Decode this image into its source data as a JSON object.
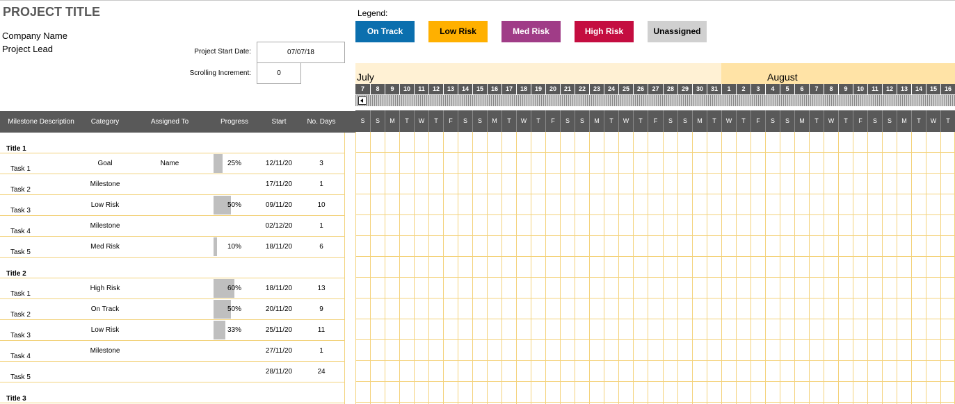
{
  "header": {
    "project_title": "PROJECT TITLE",
    "company_name": "Company Name",
    "project_lead": "Project Lead",
    "start_date_label": "Project Start Date:",
    "start_date_value": "07/07/18",
    "scroll_increment_label": "Scrolling Increment:",
    "scroll_increment_value": "0"
  },
  "legend": {
    "label": "Legend:",
    "items": [
      {
        "label": "On Track",
        "bg": "#0B6FAE",
        "fg": "#FFFFFF"
      },
      {
        "label": "Low Risk",
        "bg": "#FFB000",
        "fg": "#000000"
      },
      {
        "label": "Med Risk",
        "bg": "#A03C87",
        "fg": "#FFFFFF"
      },
      {
        "label": "High Risk",
        "bg": "#C40D40",
        "fg": "#FFFFFF"
      },
      {
        "label": "Unassigned",
        "bg": "#D0D0D0",
        "fg": "#000000"
      }
    ]
  },
  "timeline": {
    "months": [
      {
        "label": "July",
        "color": "#FFF1D4"
      },
      {
        "label": "August",
        "color": "#FFE3A6"
      }
    ],
    "dates": [
      7,
      8,
      9,
      10,
      11,
      12,
      13,
      14,
      15,
      16,
      17,
      18,
      19,
      20,
      21,
      22,
      23,
      24,
      25,
      26,
      27,
      28,
      29,
      30,
      31,
      1,
      2,
      3,
      4,
      5,
      6,
      7,
      8,
      9,
      10,
      11,
      12,
      13,
      14,
      15,
      16
    ],
    "weekdays": [
      "S",
      "S",
      "M",
      "T",
      "W",
      "T",
      "F",
      "S",
      "S",
      "M",
      "T",
      "W",
      "T",
      "F",
      "S",
      "S",
      "M",
      "T",
      "W",
      "T",
      "F",
      "S",
      "S",
      "M",
      "T",
      "W",
      "T",
      "F",
      "S",
      "S",
      "M",
      "T",
      "W",
      "T",
      "F",
      "S",
      "S",
      "M",
      "T",
      "W",
      "T"
    ]
  },
  "table": {
    "columns": [
      "Milestone Description",
      "Category",
      "Assigned To",
      "Progress",
      "Start",
      "No. Days"
    ],
    "rows": [
      {
        "type": "title",
        "label": "Title 1"
      },
      {
        "type": "task",
        "label": "Task 1",
        "category": "Goal",
        "assigned": "Name",
        "progress": 25,
        "progress_text": "25%",
        "start": "12/11/20",
        "days": "3"
      },
      {
        "type": "task",
        "label": "Task 2",
        "category": "Milestone",
        "assigned": "",
        "progress": null,
        "progress_text": "",
        "start": "17/11/20",
        "days": "1"
      },
      {
        "type": "task",
        "label": "Task 3",
        "category": "Low Risk",
        "assigned": "",
        "progress": 50,
        "progress_text": "50%",
        "start": "09/11/20",
        "days": "10"
      },
      {
        "type": "task",
        "label": "Task 4",
        "category": "Milestone",
        "assigned": "",
        "progress": null,
        "progress_text": "",
        "start": "02/12/20",
        "days": "1"
      },
      {
        "type": "task",
        "label": "Task 5",
        "category": "Med Risk",
        "assigned": "",
        "progress": 10,
        "progress_text": "10%",
        "start": "18/11/20",
        "days": "6"
      },
      {
        "type": "title",
        "label": "Title 2"
      },
      {
        "type": "task",
        "label": "Task 1",
        "category": "High Risk",
        "assigned": "",
        "progress": 60,
        "progress_text": "60%",
        "start": "18/11/20",
        "days": "13"
      },
      {
        "type": "task",
        "label": "Task 2",
        "category": "On Track",
        "assigned": "",
        "progress": 50,
        "progress_text": "50%",
        "start": "20/11/20",
        "days": "9"
      },
      {
        "type": "task",
        "label": "Task 3",
        "category": "Low Risk",
        "assigned": "",
        "progress": 33,
        "progress_text": "33%",
        "start": "25/11/20",
        "days": "11"
      },
      {
        "type": "task",
        "label": "Task 4",
        "category": "Milestone",
        "assigned": "",
        "progress": null,
        "progress_text": "",
        "start": "27/11/20",
        "days": "1"
      },
      {
        "type": "task",
        "label": "Task 5",
        "category": "",
        "assigned": "",
        "progress": null,
        "progress_text": "",
        "start": "28/11/20",
        "days": "24"
      },
      {
        "type": "title",
        "label": "Title 3"
      }
    ]
  }
}
